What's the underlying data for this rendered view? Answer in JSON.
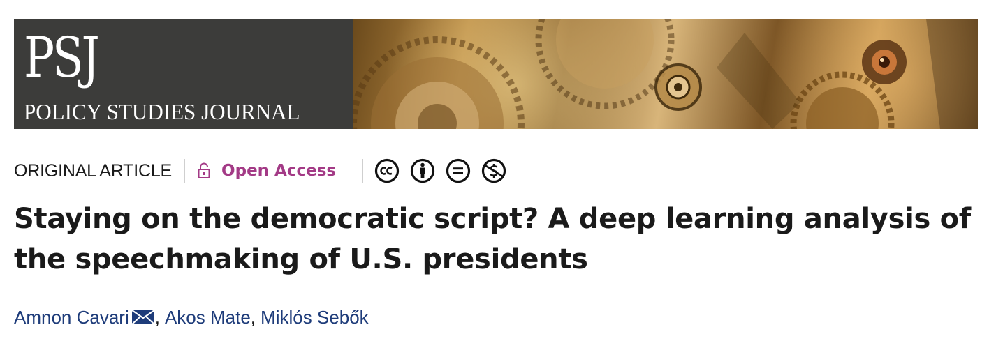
{
  "journal": {
    "abbrev": "PSJ",
    "name": "POLICY STUDIES JOURNAL"
  },
  "article": {
    "type": "ORIGINAL ARTICLE",
    "access": "Open Access",
    "licenses": [
      "cc-icon",
      "by-icon",
      "nd-icon",
      "nc-icon"
    ],
    "title": "Staying on the democratic script? A deep learning analysis of the speechmaking of U.S. presidents"
  },
  "authors": [
    {
      "name": "Amnon Cavari",
      "corresponding": true
    },
    {
      "name": "Akos Mate",
      "corresponding": false
    },
    {
      "name": "Miklós Sebők",
      "corresponding": false
    }
  ],
  "colors": {
    "banner_dark": "#3c3c3a",
    "open_access": "#a33a86",
    "author_link": "#1e3c7a"
  }
}
